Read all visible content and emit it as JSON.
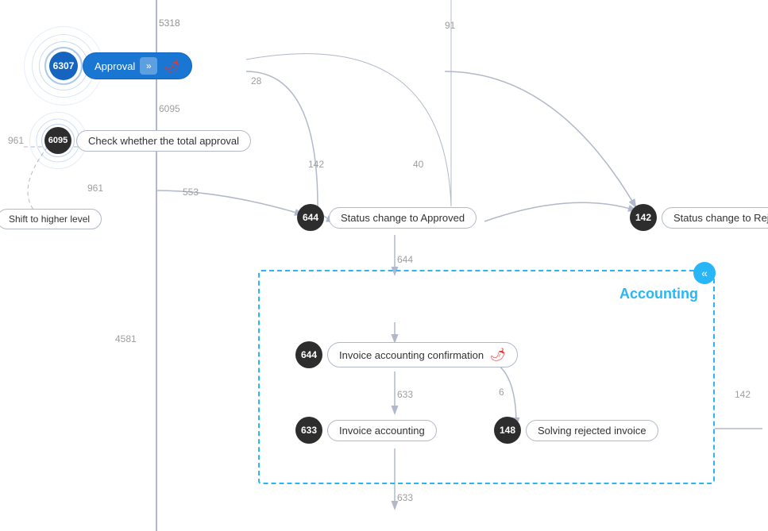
{
  "nodes": {
    "n6307": {
      "id": "6307",
      "label": "Approval",
      "type": "blue-active"
    },
    "n6095": {
      "id": "6095",
      "label": "Check whether the total approval",
      "type": "dark"
    },
    "n644_status": {
      "id": "644",
      "label": "Status change to Approved",
      "type": "dark"
    },
    "n142_status": {
      "id": "142",
      "label": "Status change to Rejected",
      "type": "dark"
    },
    "n644_invoice": {
      "id": "644",
      "label": "Invoice accounting confirmation",
      "type": "dark",
      "has_chili": true
    },
    "n633_invoice": {
      "id": "633",
      "label": "Invoice accounting",
      "type": "dark"
    },
    "n148": {
      "id": "148",
      "label": "Solving rejected invoice",
      "type": "dark"
    },
    "n_shift": {
      "label": "Shift to higher level",
      "type": "plain"
    }
  },
  "edges": {
    "e5318": "5318",
    "e6095": "6095",
    "e961_left": "961",
    "e961_bottom": "961",
    "e28": "28",
    "e91": "91",
    "e142": "142",
    "e40": "40",
    "e553": "553",
    "e644_right": "644",
    "e4581": "4581",
    "e633": "633",
    "e6": "6",
    "e142_right": "142",
    "e633_bottom": "633"
  },
  "accounting": {
    "title": "Accounting",
    "collapse_icon": "«"
  }
}
